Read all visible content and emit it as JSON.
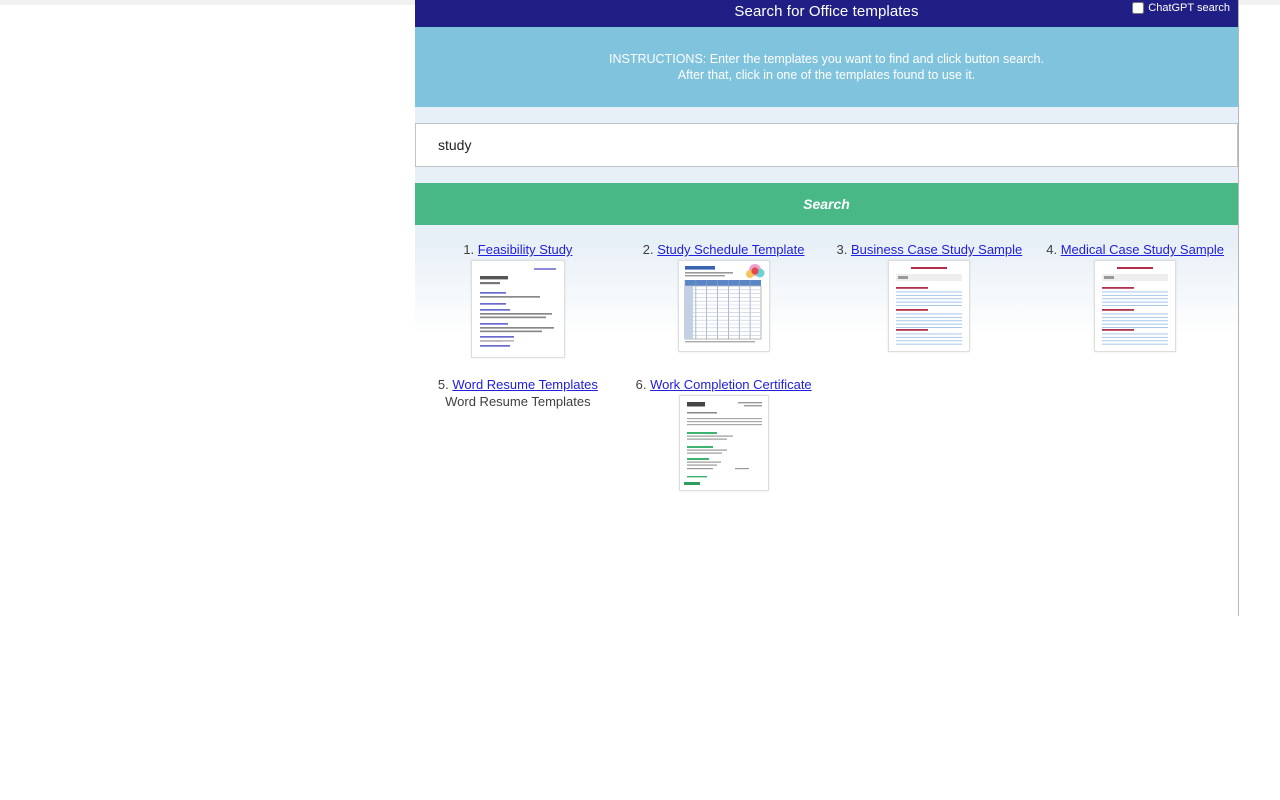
{
  "header": {
    "title": "Search for Office templates",
    "chatgpt_search_label": "ChatGPT search",
    "chatgpt_search_checked": false,
    "background_color": "#1f1f85"
  },
  "instructions": {
    "line1": "INSTRUCTIONS: Enter the templates you want to find and click button search.",
    "line2": "After that, click in one of the templates found to use it.",
    "background_color": "#7fc3dd"
  },
  "search": {
    "input_value": "study",
    "input_placeholder": "",
    "button_label": "Search",
    "button_color": "#47b886"
  },
  "results": [
    {
      "number": "1.",
      "title": "Feasibility Study",
      "thumb": "document-lines",
      "alt_text": ""
    },
    {
      "number": "2.",
      "title": "Study Schedule Template",
      "thumb": "schedule-table",
      "alt_text": ""
    },
    {
      "number": "3.",
      "title": "Business Case Study Sample",
      "thumb": "form-lines",
      "alt_text": ""
    },
    {
      "number": "4.",
      "title": "Medical Case Study Sample",
      "thumb": "form-lines",
      "alt_text": ""
    },
    {
      "number": "5.",
      "title": "Word Resume Templates",
      "thumb": "broken",
      "alt_text": "Word Resume Templates"
    },
    {
      "number": "6.",
      "title": "Work Completion Certificate",
      "thumb": "certificate",
      "alt_text": ""
    }
  ]
}
